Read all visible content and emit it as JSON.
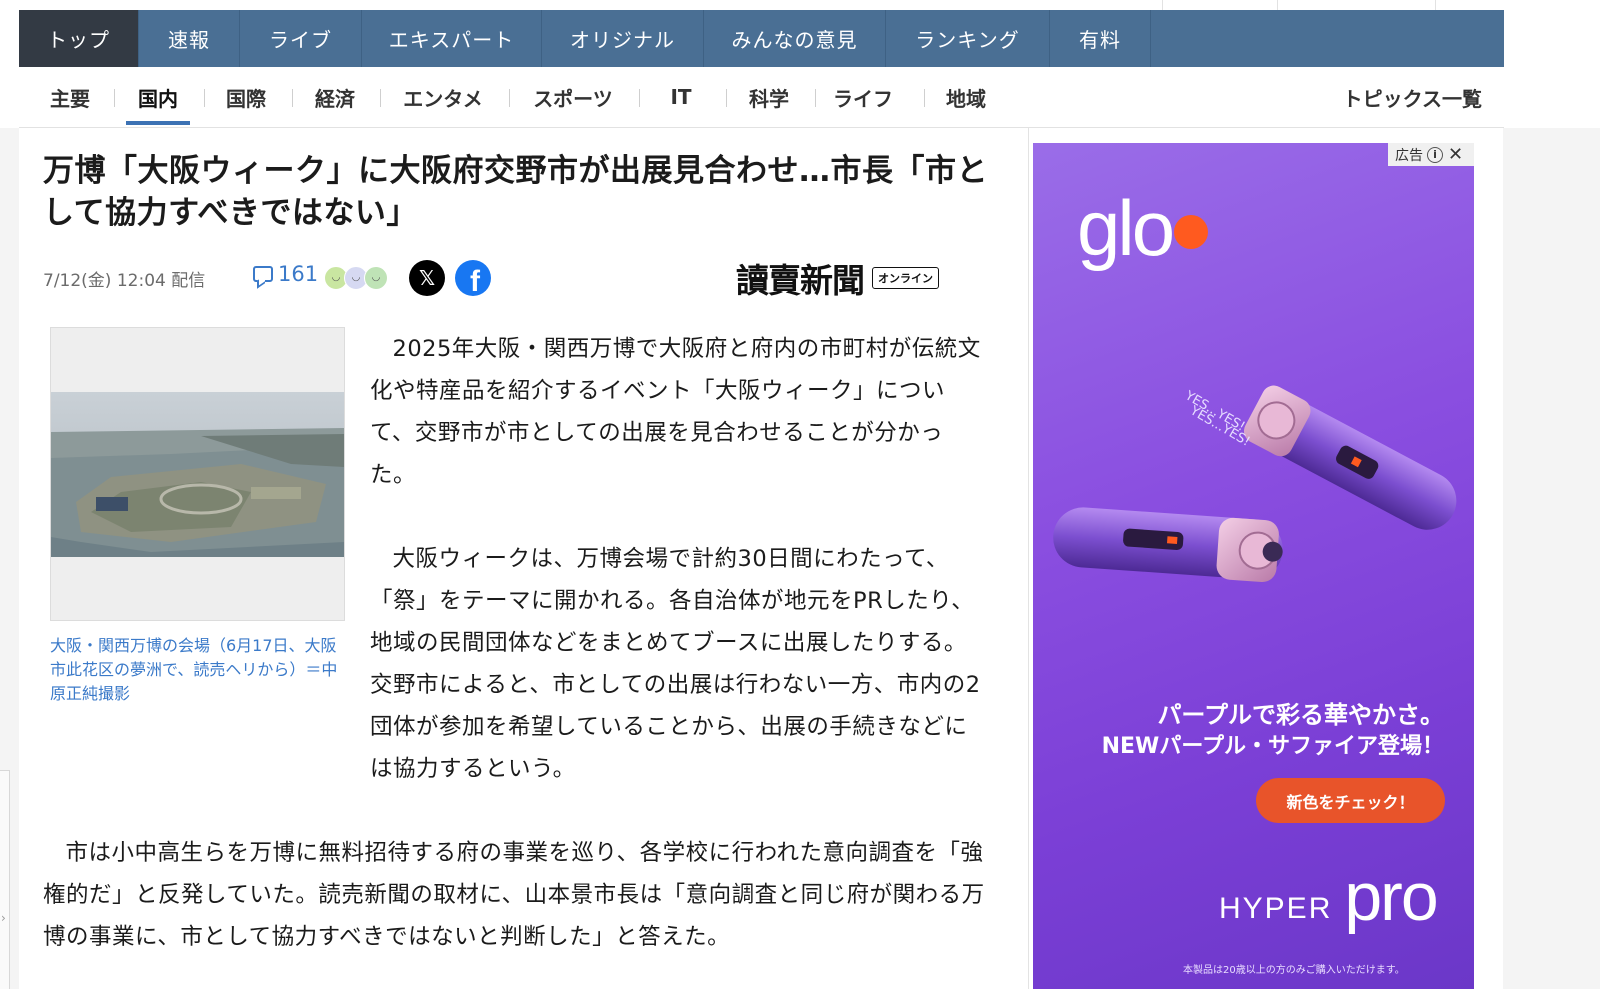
{
  "nav_primary": {
    "items": [
      {
        "label": "トップ",
        "active": true
      },
      {
        "label": "速報",
        "active": false
      },
      {
        "label": "ライブ",
        "active": false
      },
      {
        "label": "エキスパート",
        "active": false
      },
      {
        "label": "オリジナル",
        "active": false
      },
      {
        "label": "みんなの意見",
        "active": false
      },
      {
        "label": "ランキング",
        "active": false
      },
      {
        "label": "有料",
        "active": false
      }
    ],
    "background_color": "#4a6f94",
    "active_color": "#333a44"
  },
  "nav_secondary": {
    "categories": [
      {
        "label": "主要",
        "active": false
      },
      {
        "label": "国内",
        "active": true
      },
      {
        "label": "国際",
        "active": false
      },
      {
        "label": "経済",
        "active": false
      },
      {
        "label": "エンタメ",
        "active": false
      },
      {
        "label": "スポーツ",
        "active": false
      },
      {
        "label": "IT",
        "active": false
      },
      {
        "label": "科学",
        "active": false
      },
      {
        "label": "ライフ",
        "active": false
      },
      {
        "label": "地域",
        "active": false
      }
    ],
    "topics_link": "トピックス一覧",
    "active_underline_color": "#3c72b4"
  },
  "article": {
    "headline": "万博「大阪ウィーク」に大阪府交野市が出展見合わせ…市長「市として協力すべきではない」",
    "date": "7/12(金) 12:04 配信",
    "comment_count": "161",
    "publisher_name": "讀賣新聞",
    "publisher_badge": "オンライン",
    "share": {
      "x_icon": "x-logo",
      "facebook_icon": "facebook-logo"
    },
    "photo_caption": "大阪・関西万博の会場（6月17日、大阪市此花区の夢洲で、読売ヘリから）＝中原正純撮影",
    "paragraphs": [
      "2025年大阪・関西万博で大阪府と府内の市町村が伝統文化や特産品を紹介するイベント「大阪ウィーク」について、交野市が市としての出展を見合わせることが分かった。",
      "大阪ウィークは、万博会場で計約30日間にわたって、「祭」をテーマに開かれる。各自治体が地元をPRしたり、地域の民間団体などをまとめてブースに出展したりする。交野市によると、市としての出展は行わない一方、市内の2団体が参加を希望していることから、出展の手続きなどには協力するという。",
      "市は小中高生らを万博に無料招待する府の事業を巡り、各学校に行われた意向調査を「強権的だ」と反発していた。読売新聞の取材に、山本景市長は「意向調査と同じ府が関わる万博の事業に、市として協力すべきではないと判断した」と答えた。"
    ]
  },
  "ad": {
    "label": "広告",
    "brand": "glo",
    "copy_line1": "パープルで彩る華やかさ。",
    "copy_line2": "NEWパープル・サファイア登場！",
    "cta": "新色をチェック！",
    "product_hyper": "HYPER",
    "product_pro": "pro",
    "device_text_1": "YES...YES!",
    "device_text_2": "YES...YES!",
    "footnote": "本製品は20歳以上の方のみご購入いただけます。",
    "colors": {
      "background": "#8a4ee0",
      "cta": "#e8542a",
      "brand_dot": "#ff5a1f"
    }
  }
}
